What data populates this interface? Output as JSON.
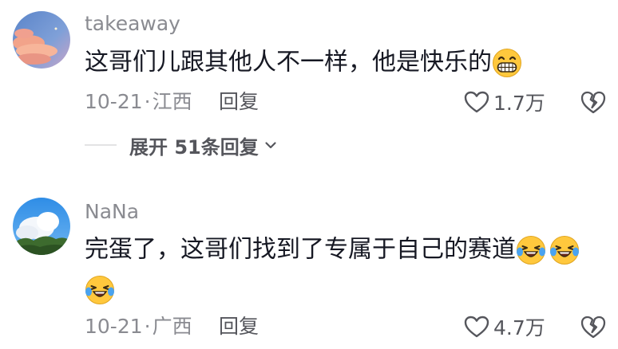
{
  "comments": [
    {
      "username": "takeaway",
      "text": "这哥们儿跟其他人不一样，他是快乐的",
      "emojis": [
        "grin-emoji"
      ],
      "date": "10-21",
      "separator": "·",
      "location": "江西",
      "reply_label": "回复",
      "likes": "1.7万",
      "expand_replies_label": "展开 51条回复"
    },
    {
      "username": "NaNa",
      "text": "完蛋了，这哥们找到了专属于自己的赛道",
      "emojis": [
        "laugh-cry-emoji",
        "laugh-cry-emoji",
        "laugh-cry-emoji"
      ],
      "date": "10-21",
      "separator": "·",
      "location": "广西",
      "reply_label": "回复",
      "likes": "4.7万"
    }
  ],
  "icons": {
    "like": "heart-outline-icon",
    "dislike": "broken-heart-icon",
    "expand": "chevron-down-icon"
  },
  "colors": {
    "text_primary": "#161823",
    "text_secondary": "#8a8b91",
    "action_text": "#55565c",
    "emoji_yellow": "#ffc83d",
    "tear_blue": "#4aa3f0"
  }
}
